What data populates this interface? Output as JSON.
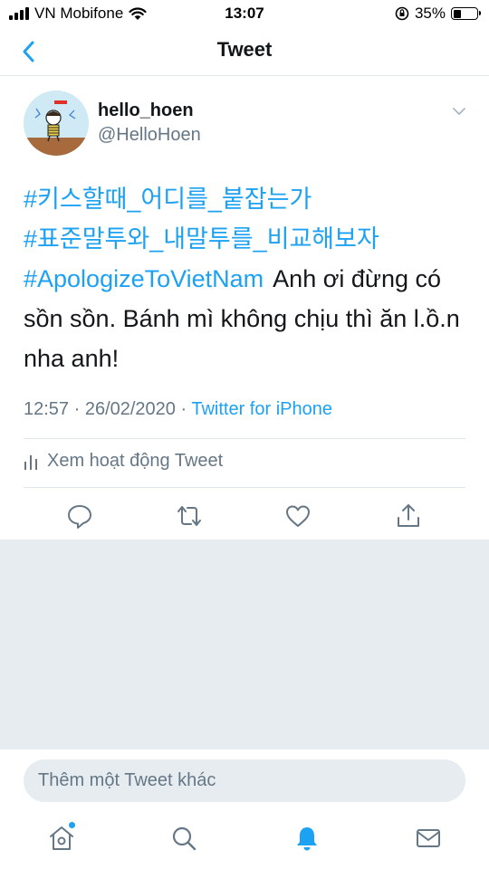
{
  "status_bar": {
    "carrier": "VN Mobifone",
    "time": "13:07",
    "battery_percent": "35%",
    "battery_level": 0.35
  },
  "nav": {
    "title": "Tweet",
    "back_icon": "chevron-left-icon"
  },
  "tweet": {
    "display_name": "hello_hoen",
    "handle": "@HelloHoen",
    "hashtags": [
      "#키스할때_어디를_붙잡는가",
      "#표준말투와_내말투를_비교해보자",
      "#ApologizeToVietNam"
    ],
    "text": "Anh ơi đừng có sồn sồn. Bánh mì không chịu thì ăn l.ồ.n nha anh!",
    "timestamp": "12:57 · 26/02/2020 · ",
    "source": "Twitter for iPhone",
    "activity_label": "Xem hoạt động Tweet"
  },
  "actions": [
    "reply-icon",
    "retweet-icon",
    "like-icon",
    "share-icon"
  ],
  "reply_box": {
    "placeholder": "Thêm một Tweet khác"
  },
  "tab_bar": [
    "home-icon",
    "search-icon",
    "notifications-icon",
    "messages-icon"
  ],
  "colors": {
    "accent": "#1da1f2",
    "secondary_text": "#657786",
    "divider": "#e1e8ed",
    "background_gray": "#e6ecf0"
  }
}
